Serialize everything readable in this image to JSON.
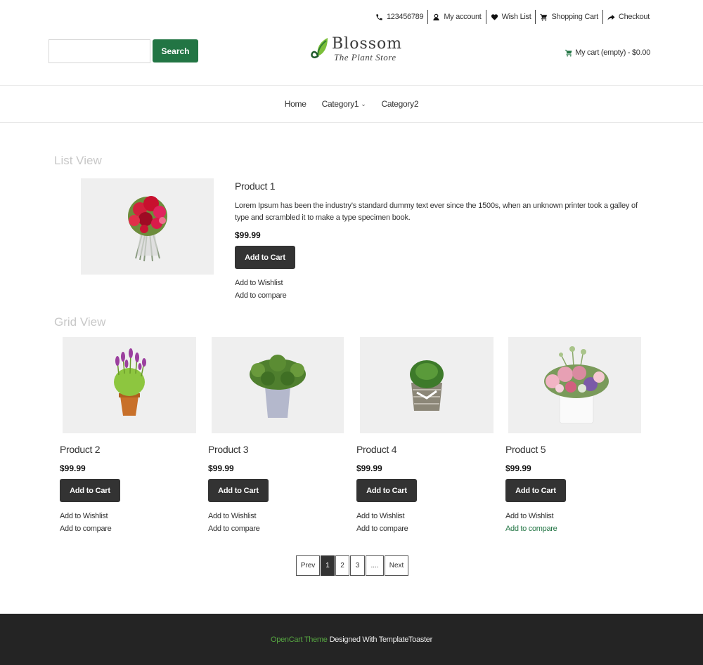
{
  "toplinks": {
    "phone": "123456789",
    "account": "My account",
    "wishlist": "Wish List",
    "cart": "Shopping Cart",
    "checkout": "Checkout"
  },
  "header": {
    "search_placeholder": "",
    "search_value": "",
    "search_button": "Search",
    "logo_name": "Blossom",
    "logo_tagline": "The Plant Store",
    "mycart": "My cart (empty) - $0.00"
  },
  "colors": {
    "accent": "#227544",
    "button_dark": "#333333",
    "footer_bg": "#242424",
    "footer_highlight": "#56a541",
    "image_bg": "#efefef"
  },
  "nav": {
    "items": [
      {
        "label": "Home"
      },
      {
        "label": "Category1",
        "has_dropdown": true
      },
      {
        "label": "Category2"
      }
    ]
  },
  "list_view": {
    "title": "List View",
    "product": {
      "name": "Product 1",
      "description": "Lorem Ipsum has been the industry's standard dummy text ever since the 1500s, when an unknown printer took a galley of type and scrambled it to make a type specimen book.",
      "price": "$99.99",
      "add_to_cart": "Add to Cart",
      "add_to_wishlist": "Add to Wishlist",
      "add_to_compare": "Add to compare",
      "image": "red-bouquet"
    }
  },
  "grid_view": {
    "title": "Grid View",
    "products": [
      {
        "name": "Product 2",
        "price": "$99.99",
        "add_to_cart": "Add to Cart",
        "add_to_wishlist": "Add to Wishlist",
        "add_to_compare": "Add to compare",
        "image": "lavender-pot"
      },
      {
        "name": "Product 3",
        "price": "$99.99",
        "add_to_cart": "Add to Cart",
        "add_to_wishlist": "Add to Wishlist",
        "add_to_compare": "Add to compare",
        "image": "herb-grey-pot"
      },
      {
        "name": "Product 4",
        "price": "$99.99",
        "add_to_cart": "Add to Cart",
        "add_to_wishlist": "Add to Wishlist",
        "add_to_compare": "Add to compare",
        "image": "moss-basket"
      },
      {
        "name": "Product 5",
        "price": "$99.99",
        "add_to_cart": "Add to Cart",
        "add_to_wishlist": "Add to Wishlist",
        "add_to_compare": "Add to compare",
        "image": "pink-flower-box",
        "compare_hovered": true
      }
    ]
  },
  "pagination": {
    "prev": "Prev",
    "pages": [
      "1",
      "2",
      "3",
      "...."
    ],
    "active": "1",
    "next": "Next"
  },
  "footer": {
    "highlight": "OpenCart Theme",
    "text": "Designed With TemplateToaster"
  }
}
